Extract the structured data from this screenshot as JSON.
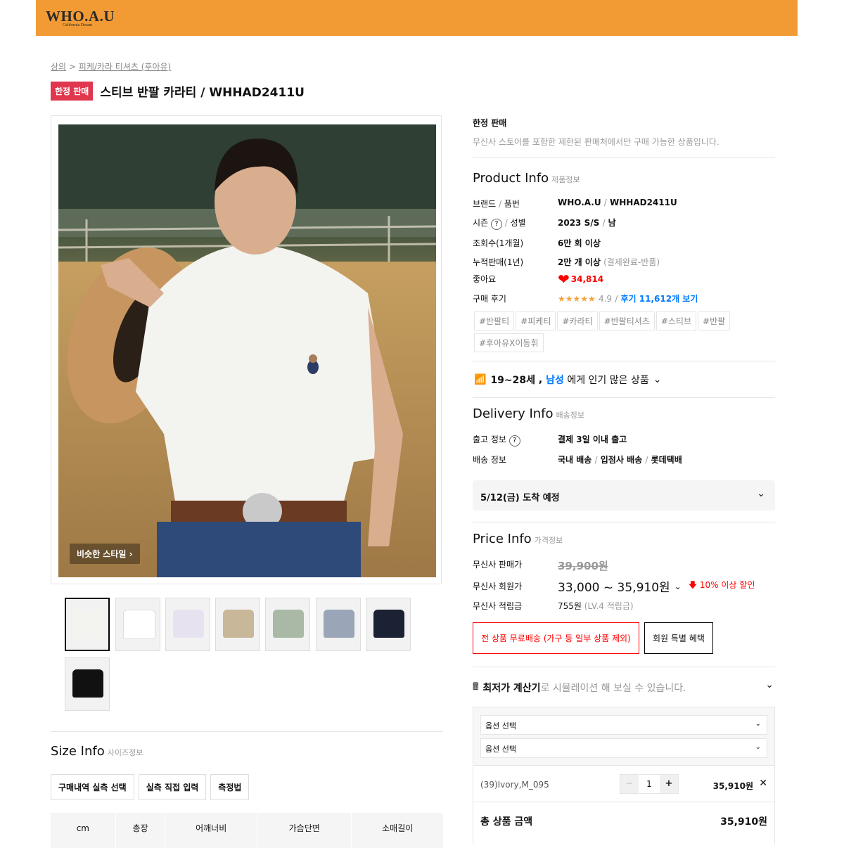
{
  "brand": {
    "logo": "WHO.A.U",
    "logo_sub": "California Dream"
  },
  "breadcrumb": {
    "cat1": "상의",
    "sep": " > ",
    "cat2": "피케/카라 티셔츠 (후아유)"
  },
  "product": {
    "badge": "한정 판매",
    "title": "스티브 반팔 카라티 / WHHAD2411U",
    "similar_style": "비슷한 스타일"
  },
  "thumbnails": [
    {
      "color": "#8a6a45"
    },
    {
      "color": "#ffffff"
    },
    {
      "color": "#e6e2ef"
    },
    {
      "color": "#c9b79a"
    },
    {
      "color": "#a9b9a6"
    },
    {
      "color": "#9aa6b8"
    },
    {
      "color": "#1b2233"
    },
    {
      "color": "#111111"
    }
  ],
  "limited": {
    "title": "한정 판매",
    "desc": "무신사 스토어를 포함한 제한된 판매처에서만 구매 가능한 상품입니다."
  },
  "product_info": {
    "title": "Product Info",
    "sub": "제품정보",
    "brand_label": "브랜드",
    "code_label": "품번",
    "brand": "WHO.A.U",
    "code": "WHHAD2411U",
    "season_label": "시즌",
    "gender_label": "성별",
    "season": "2023 S/S",
    "gender": "남",
    "views_label": "조회수(1개월)",
    "views": "6만 회 이상",
    "sales_label": "누적판매(1년)",
    "sales": "2만 개 이상",
    "sales_note": "(결제완료-반품)",
    "likes_label": "좋아요",
    "likes": "34,814",
    "review_label": "구매 후기",
    "stars": "★★★★★",
    "rating": "4.9",
    "review_link": "후기 11,612개 보기",
    "tags": [
      "#반팔티",
      "#피케티",
      "#카라티",
      "#반팔티셔츠",
      "#스티브",
      "#반팔",
      "#후아유X이동휘"
    ]
  },
  "popular": {
    "age": "19~28세",
    "gender": "남성",
    "text": "에게 인기 많은 상품"
  },
  "delivery": {
    "title": "Delivery Info",
    "sub": "배송정보",
    "ship_label": "출고 정보",
    "ship": "결제 3일 이내 출고",
    "method_label": "배송 정보",
    "m1": "국내 배송",
    "m2": "입점사 배송",
    "m3": "롯데택배",
    "arrival": "5/12(금) 도착 예정"
  },
  "price": {
    "title": "Price Info",
    "sub": "가격정보",
    "sale_label": "무신사 판매가",
    "sale": "39,900원",
    "member_label": "무신사 회원가",
    "member": "33,000 ~ 35,910원",
    "discount": "10% 이상 할인",
    "points_label": "무신사 적립금",
    "points": "755원",
    "points_note": "(LV.4 적립금)",
    "free_ship": "전 상품 무료배송 (가구 등 일부 상품 제외)",
    "member_benefit": "회원 특별 혜택"
  },
  "calculator": {
    "title": "최저가 계산기",
    "text": "로 시뮬레이션 해 보실 수 있습니다."
  },
  "options": {
    "select1": "옵션 선택",
    "select2": "옵션 선택",
    "item_name": "(39)Ivory,M_095",
    "qty": "1",
    "item_price": "35,910원",
    "total_label": "총 상품 금액",
    "total": "35,910원"
  },
  "size_info": {
    "title": "Size Info",
    "sub": "사이즈정보",
    "btn1": "구매내역 실측 선택",
    "btn2": "실측 직접 입력",
    "btn3": "측정법",
    "headers": [
      "cm",
      "총장",
      "어깨너비",
      "가슴단면",
      "소매길이"
    ]
  },
  "colors": {
    "brand_bar": "#f29b35",
    "badge": "#e0364e",
    "link_blue": "#0078ff",
    "sale_red": "#ff0000"
  }
}
